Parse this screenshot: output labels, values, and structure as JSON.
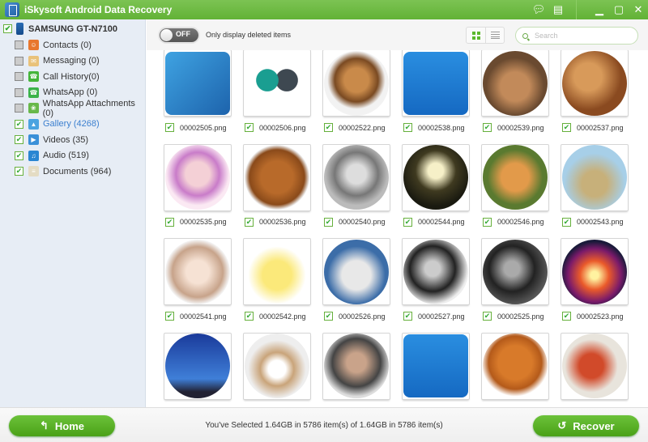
{
  "window": {
    "title": "iSkysoft Android Data Recovery",
    "controls": [
      "feedback-icon",
      "register-icon",
      "minimize-icon",
      "maximize-icon",
      "close-icon"
    ]
  },
  "sidebar": {
    "device": {
      "name": "SAMSUNG GT-N7100",
      "checked": true
    },
    "items": [
      {
        "label": "Contacts (0)",
        "icon": "contacts-icon",
        "checked": false,
        "color": "#e8772e",
        "active": false
      },
      {
        "label": "Messaging (0)",
        "icon": "messaging-icon",
        "checked": false,
        "color": "#e9c27a",
        "active": false
      },
      {
        "label": "Call History(0)",
        "icon": "call-history-icon",
        "checked": false,
        "color": "#45b53a",
        "active": false
      },
      {
        "label": "WhatsApp (0)",
        "icon": "whatsapp-icon",
        "checked": false,
        "color": "#3bb34a",
        "active": false
      },
      {
        "label": "WhatsApp Attachments  (0)",
        "icon": "attachment-icon",
        "checked": false,
        "color": "#68b84a",
        "active": false
      },
      {
        "label": "Gallery (4268)",
        "icon": "gallery-icon",
        "checked": true,
        "color": "#4ba3e0",
        "active": true
      },
      {
        "label": "Videos (35)",
        "icon": "videos-icon",
        "checked": true,
        "color": "#3a90d8",
        "active": false
      },
      {
        "label": "Audio (519)",
        "icon": "audio-icon",
        "checked": true,
        "color": "#2a86d2",
        "active": false
      },
      {
        "label": "Documents (964)",
        "icon": "documents-icon",
        "checked": true,
        "color": "#e4dcc4",
        "active": false
      }
    ]
  },
  "toolbar": {
    "toggle_state": "OFF",
    "toggle_label": "Only display deleted items",
    "view_modes": [
      "grid",
      "list"
    ],
    "active_view": "grid",
    "search_placeholder": "Search",
    "search_value": ""
  },
  "gallery": {
    "items": [
      {
        "name": "00002505.png",
        "checked": true,
        "thumb": "blue-arrow-app-icon"
      },
      {
        "name": "00002506.png",
        "checked": true,
        "thumb": "two-faces-app-icon"
      },
      {
        "name": "00002522.png",
        "checked": true,
        "thumb": "beagle-photo"
      },
      {
        "name": "00002538.png",
        "checked": true,
        "thumb": "maxthon-app-icon"
      },
      {
        "name": "00002539.png",
        "checked": true,
        "thumb": "sleeping-cat-photo"
      },
      {
        "name": "00002537.png",
        "checked": true,
        "thumb": "cat-on-guitar-photo"
      },
      {
        "name": "00002535.png",
        "checked": true,
        "thumb": "anime-girl-flowers"
      },
      {
        "name": "00002536.png",
        "checked": true,
        "thumb": "happy-dog-photo"
      },
      {
        "name": "00002540.png",
        "checked": true,
        "thumb": "sketch-geisha"
      },
      {
        "name": "00002544.png",
        "checked": true,
        "thumb": "daisies-photo"
      },
      {
        "name": "00002546.png",
        "checked": true,
        "thumb": "kitten-photo"
      },
      {
        "name": "00002543.png",
        "checked": true,
        "thumb": "fairytale-houses"
      },
      {
        "name": "00002541.png",
        "checked": true,
        "thumb": "anime-girl-portrait"
      },
      {
        "name": "00002542.png",
        "checked": true,
        "thumb": "cartoon-dog"
      },
      {
        "name": "00002526.png",
        "checked": true,
        "thumb": "white-cat-photo"
      },
      {
        "name": "00002527.png",
        "checked": true,
        "thumb": "woman-bw-photo"
      },
      {
        "name": "00002525.png",
        "checked": true,
        "thumb": "smoking-man-bw"
      },
      {
        "name": "00002523.png",
        "checked": true,
        "thumb": "sunset-photo"
      },
      {
        "name": "",
        "checked": true,
        "thumb": "blue-sky-photo"
      },
      {
        "name": "",
        "checked": true,
        "thumb": "group-with-sign-photo"
      },
      {
        "name": "",
        "checked": true,
        "thumb": "smoking-man-photo"
      },
      {
        "name": "",
        "checked": true,
        "thumb": "maxthon-app-icon"
      },
      {
        "name": "",
        "checked": true,
        "thumb": "dachshund-photo"
      },
      {
        "name": "",
        "checked": true,
        "thumb": "red-chair-photo"
      }
    ]
  },
  "footer": {
    "home_label": "Home",
    "recover_label": "Recover",
    "status": "You've Selected 1.64GB in 5786 item(s) of 1.64GB in 5786 item(s)"
  }
}
